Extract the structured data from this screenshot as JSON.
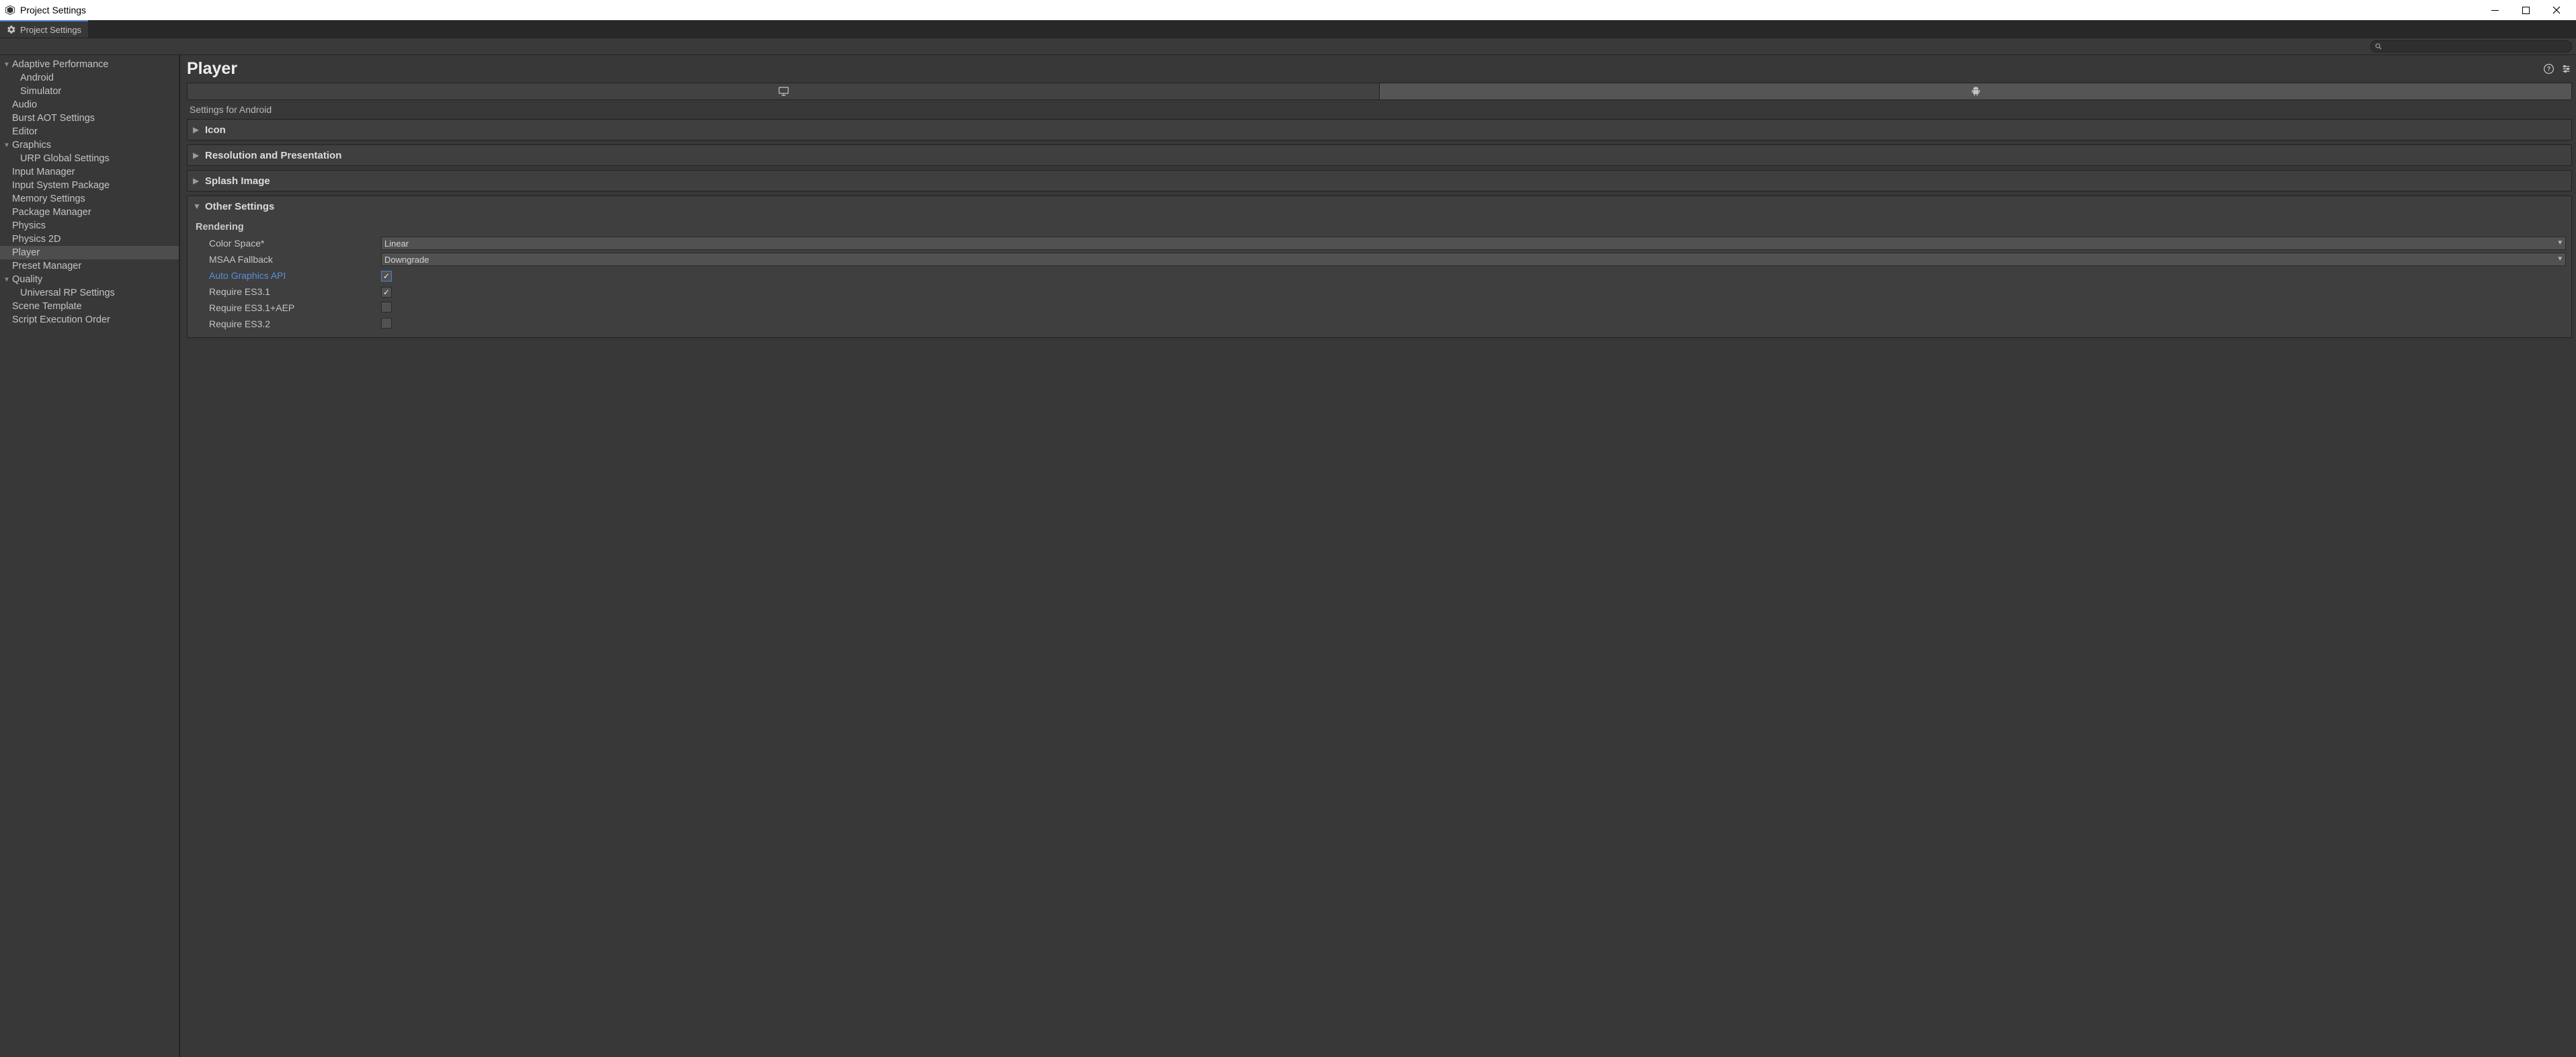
{
  "window": {
    "title": "Project Settings"
  },
  "tab": {
    "label": "Project Settings"
  },
  "search": {
    "placeholder": ""
  },
  "sidebar": {
    "items": [
      {
        "label": "Adaptive Performance",
        "name": "sidebar-item-adaptive-performance",
        "indent": 0,
        "expanded": true,
        "hasChildren": true
      },
      {
        "label": "Android",
        "name": "sidebar-item-android",
        "indent": 1
      },
      {
        "label": "Simulator",
        "name": "sidebar-item-simulator",
        "indent": 1
      },
      {
        "label": "Audio",
        "name": "sidebar-item-audio",
        "indent": 0
      },
      {
        "label": "Burst AOT Settings",
        "name": "sidebar-item-burst-aot-settings",
        "indent": 0
      },
      {
        "label": "Editor",
        "name": "sidebar-item-editor",
        "indent": 0
      },
      {
        "label": "Graphics",
        "name": "sidebar-item-graphics",
        "indent": 0,
        "expanded": true,
        "hasChildren": true
      },
      {
        "label": "URP Global Settings",
        "name": "sidebar-item-urp-global-settings",
        "indent": 1
      },
      {
        "label": "Input Manager",
        "name": "sidebar-item-input-manager",
        "indent": 0
      },
      {
        "label": "Input System Package",
        "name": "sidebar-item-input-system-package",
        "indent": 0
      },
      {
        "label": "Memory Settings",
        "name": "sidebar-item-memory-settings",
        "indent": 0
      },
      {
        "label": "Package Manager",
        "name": "sidebar-item-package-manager",
        "indent": 0
      },
      {
        "label": "Physics",
        "name": "sidebar-item-physics",
        "indent": 0
      },
      {
        "label": "Physics 2D",
        "name": "sidebar-item-physics-2d",
        "indent": 0
      },
      {
        "label": "Player",
        "name": "sidebar-item-player",
        "indent": 0,
        "selected": true
      },
      {
        "label": "Preset Manager",
        "name": "sidebar-item-preset-manager",
        "indent": 0
      },
      {
        "label": "Quality",
        "name": "sidebar-item-quality",
        "indent": 0,
        "expanded": true,
        "hasChildren": true
      },
      {
        "label": "Universal RP Settings",
        "name": "sidebar-item-universal-rp-settings",
        "indent": 1
      },
      {
        "label": "Scene Template",
        "name": "sidebar-item-scene-template",
        "indent": 0
      },
      {
        "label": "Script Execution Order",
        "name": "sidebar-item-script-execution-order",
        "indent": 0
      }
    ]
  },
  "page": {
    "title": "Player",
    "sectionLabel": "Settings for Android",
    "foldouts": {
      "icon": "Icon",
      "resolution": "Resolution and Presentation",
      "splash": "Splash Image",
      "other": "Other Settings"
    },
    "rendering": {
      "header": "Rendering",
      "colorSpace": {
        "label": "Color Space*",
        "value": "Linear"
      },
      "msaaFallback": {
        "label": "MSAA Fallback",
        "value": "Downgrade"
      },
      "autoGraphicsAPI": {
        "label": "Auto Graphics API",
        "checked": true
      },
      "requireES31": {
        "label": "Require ES3.1",
        "checked": true
      },
      "requireES31AEP": {
        "label": "Require ES3.1+AEP",
        "checked": false
      },
      "requireES32": {
        "label": "Require ES3.2",
        "checked": false
      }
    }
  }
}
